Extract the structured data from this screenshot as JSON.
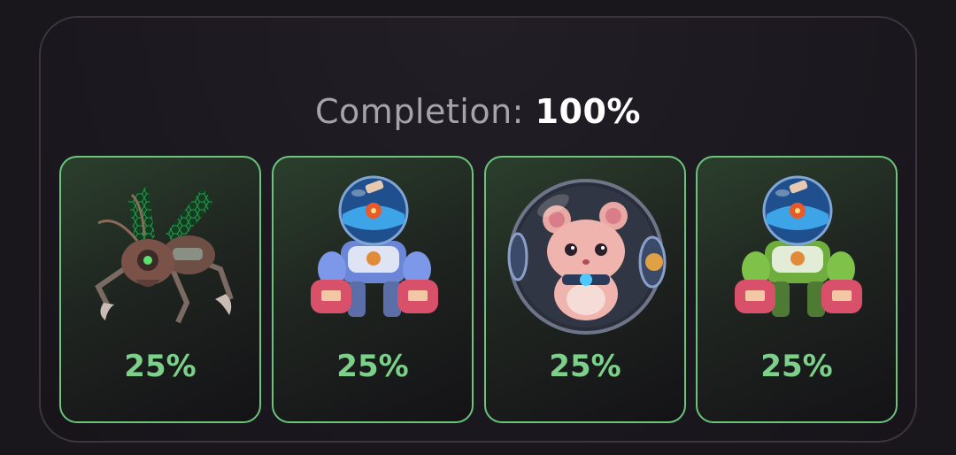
{
  "header": {
    "label": "Completion:",
    "value": "100%"
  },
  "cards": [
    {
      "character": "robot-ant-icon",
      "percent": "25%"
    },
    {
      "character": "blue-astronaut-robot-icon",
      "percent": "25%"
    },
    {
      "character": "hamster-ball-icon",
      "percent": "25%"
    },
    {
      "character": "green-astronaut-robot-icon",
      "percent": "25%"
    }
  ],
  "colors": {
    "accent": "#7cd08a",
    "card_border": "#6cc47a",
    "background": "#19161c"
  }
}
